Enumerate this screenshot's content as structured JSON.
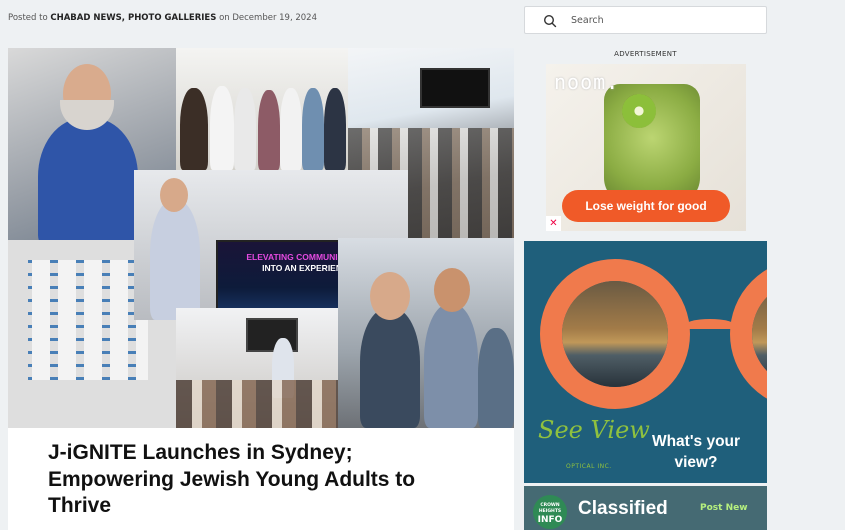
{
  "post_meta": {
    "prefix": "Posted to",
    "categories": "CHABAD NEWS, PHOTO GALLERIES",
    "on": "on",
    "date": "December 19, 2024"
  },
  "post": {
    "title": "J-iGNITE Launches in Sydney; Empowering Jewish Young Adults to Thrive",
    "screen_text_line1": "ELEVATING COMMUNICATION",
    "screen_text_line2": "INTO AN EXPERIENCE"
  },
  "search": {
    "placeholder": "Search"
  },
  "ads": {
    "label": "ADVERTISEMENT",
    "noom": {
      "logo": "noom.",
      "cta": "Lose weight for good",
      "brand_color": "#f05a28"
    },
    "seeview": {
      "logo": "See View",
      "sub": "OPTICAL INC.",
      "tagline": "What's your view?",
      "frame_color": "#f07a4c",
      "bg_color": "#1f5f7b"
    }
  },
  "classified": {
    "badge_top": "CROWN HEIGHTS",
    "badge_main": "INFO",
    "title": "Classified",
    "post_new": "Post New"
  }
}
